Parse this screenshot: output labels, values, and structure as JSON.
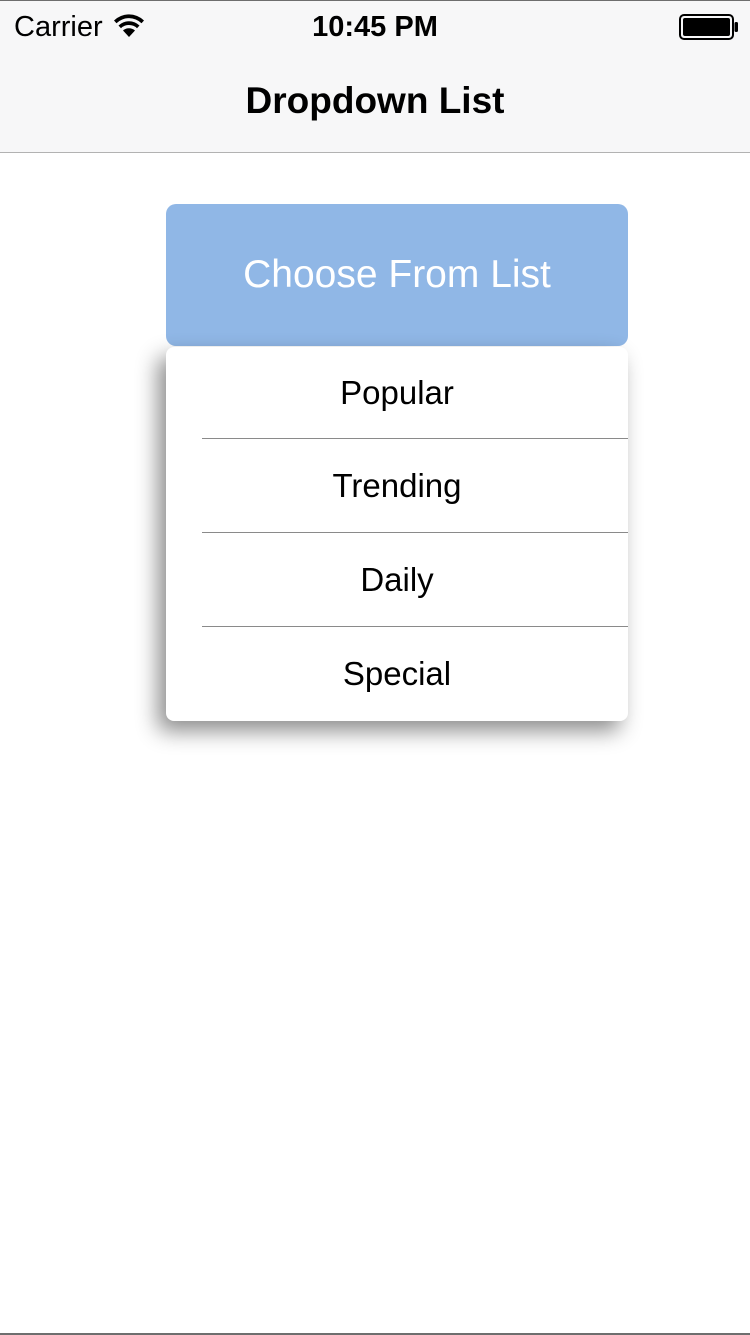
{
  "status_bar": {
    "carrier": "Carrier",
    "time": "10:45 PM",
    "wifi_icon": "wifi-icon",
    "battery_icon": "battery-icon"
  },
  "nav_bar": {
    "title": "Dropdown List"
  },
  "dropdown": {
    "button_label": "Choose From List",
    "button_color": "#90b7e6",
    "items": [
      {
        "label": "Popular"
      },
      {
        "label": "Trending"
      },
      {
        "label": "Daily"
      },
      {
        "label": "Special"
      }
    ]
  }
}
